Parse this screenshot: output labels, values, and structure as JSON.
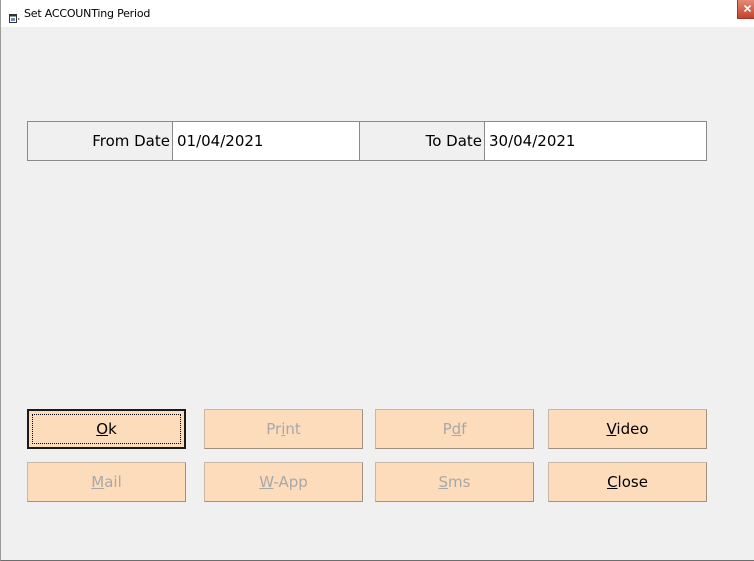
{
  "window": {
    "title": "Set ACCOUNTing Period",
    "icon": "app-window-icon",
    "close_icon": "close-icon"
  },
  "period": {
    "from_label": "From Date",
    "from_value": "01/04/2021",
    "to_label": "To Date",
    "to_value": "30/04/2021"
  },
  "buttons": [
    {
      "id": "ok",
      "pre": "",
      "key": "O",
      "post": "k",
      "enabled": true,
      "focused": true
    },
    {
      "id": "print",
      "pre": "Pr",
      "key": "i",
      "post": "nt",
      "enabled": false,
      "focused": false
    },
    {
      "id": "pdf",
      "pre": "P",
      "key": "d",
      "post": "f",
      "enabled": false,
      "focused": false
    },
    {
      "id": "video",
      "pre": "",
      "key": "V",
      "post": "ideo",
      "enabled": true,
      "focused": false
    },
    {
      "id": "mail",
      "pre": "",
      "key": "M",
      "post": "ail",
      "enabled": false,
      "focused": false
    },
    {
      "id": "wapp",
      "pre": "",
      "key": "W",
      "post": "-App",
      "enabled": false,
      "focused": false
    },
    {
      "id": "sms",
      "pre": "",
      "key": "S",
      "post": "ms",
      "enabled": false,
      "focused": false
    },
    {
      "id": "close",
      "pre": "",
      "key": "C",
      "post": "lose",
      "enabled": true,
      "focused": false
    }
  ],
  "colors": {
    "button_bg": "#fddcbc",
    "disabled_text": "#a8a8a8",
    "window_bg": "#f0f0f0"
  }
}
